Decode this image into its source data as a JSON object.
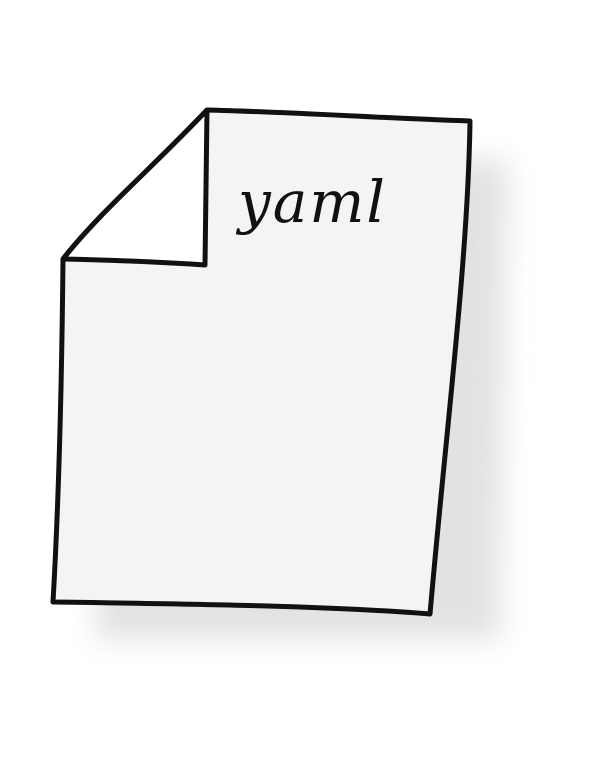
{
  "document": {
    "label": "yaml",
    "icon": "document-file-icon"
  },
  "colors": {
    "paper": "#f4f4f4",
    "outline": "#111111",
    "shadow": "#d9d9d9",
    "fold": "#ffffff"
  }
}
